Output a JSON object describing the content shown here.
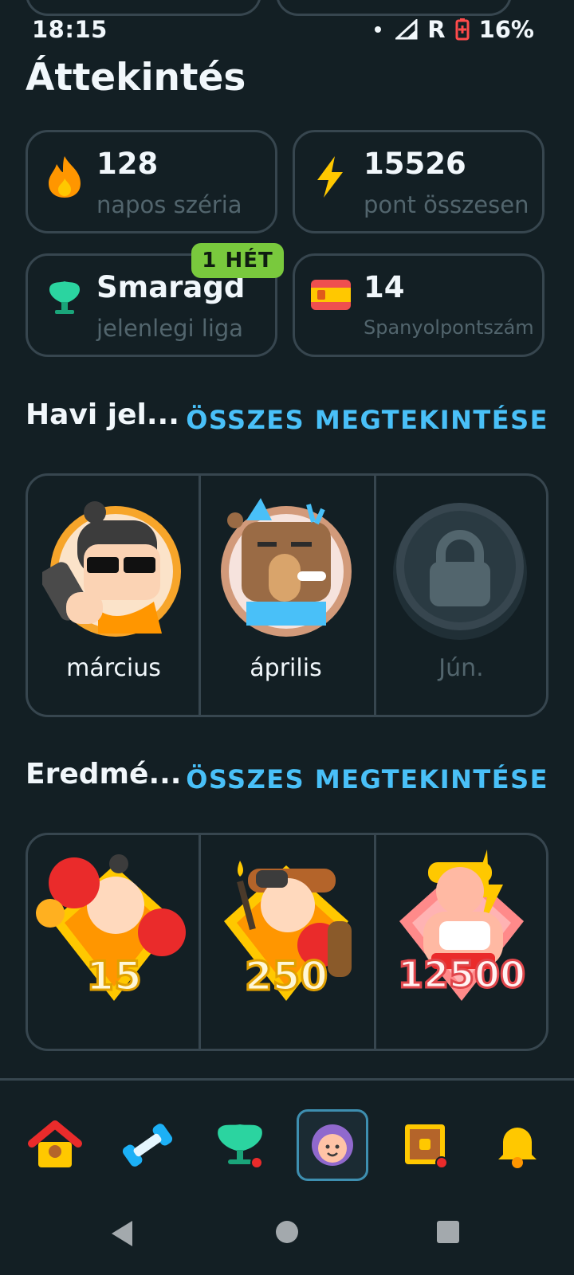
{
  "status_bar": {
    "time": "18:15",
    "network_label": "R",
    "battery": "16%"
  },
  "page": {
    "title": "Áttekintés"
  },
  "stats": [
    {
      "value": "128",
      "label": "napos széria",
      "icon": "fire-icon"
    },
    {
      "value": "15526",
      "label": "pont összesen",
      "icon": "lightning-icon"
    },
    {
      "value": "Smaragd",
      "label": "jelenlegi liga",
      "icon": "emerald-league-icon",
      "badge": "1 HÉT"
    },
    {
      "value": "14",
      "label": "Spanyolpontszám",
      "icon": "spain-flag-icon"
    }
  ],
  "monthly": {
    "title": "Havi jel...",
    "see_all": "ÖSSZES MEGTEKINTÉSE",
    "items": [
      {
        "label": "március",
        "icon": "march-badge-icon",
        "locked": false
      },
      {
        "label": "április",
        "icon": "april-badge-icon",
        "locked": false
      },
      {
        "label": "Jún.",
        "icon": "lock-icon",
        "locked": true
      }
    ]
  },
  "achievements": {
    "title": "Eredmé...",
    "see_all": "ÖSSZES MEGTEKINTÉSE",
    "items": [
      {
        "value": "15",
        "icon": "boxing-achievement-icon"
      },
      {
        "value": "250",
        "icon": "welder-achievement-icon"
      },
      {
        "value": "12500",
        "icon": "strongman-achievement-icon"
      }
    ]
  },
  "bottom_nav": [
    {
      "name": "home",
      "icon": "home-icon"
    },
    {
      "name": "practice",
      "icon": "dumbbell-icon"
    },
    {
      "name": "leagues",
      "icon": "league-icon"
    },
    {
      "name": "profile",
      "icon": "profile-avatar-icon",
      "active": true
    },
    {
      "name": "quests",
      "icon": "treasure-chest-icon"
    },
    {
      "name": "notifications",
      "icon": "bell-icon"
    }
  ],
  "colors": {
    "background": "#131f24",
    "border": "#37464f",
    "accent_blue": "#49c0f8",
    "badge_green": "#79c93d",
    "muted_text": "#52656d"
  }
}
